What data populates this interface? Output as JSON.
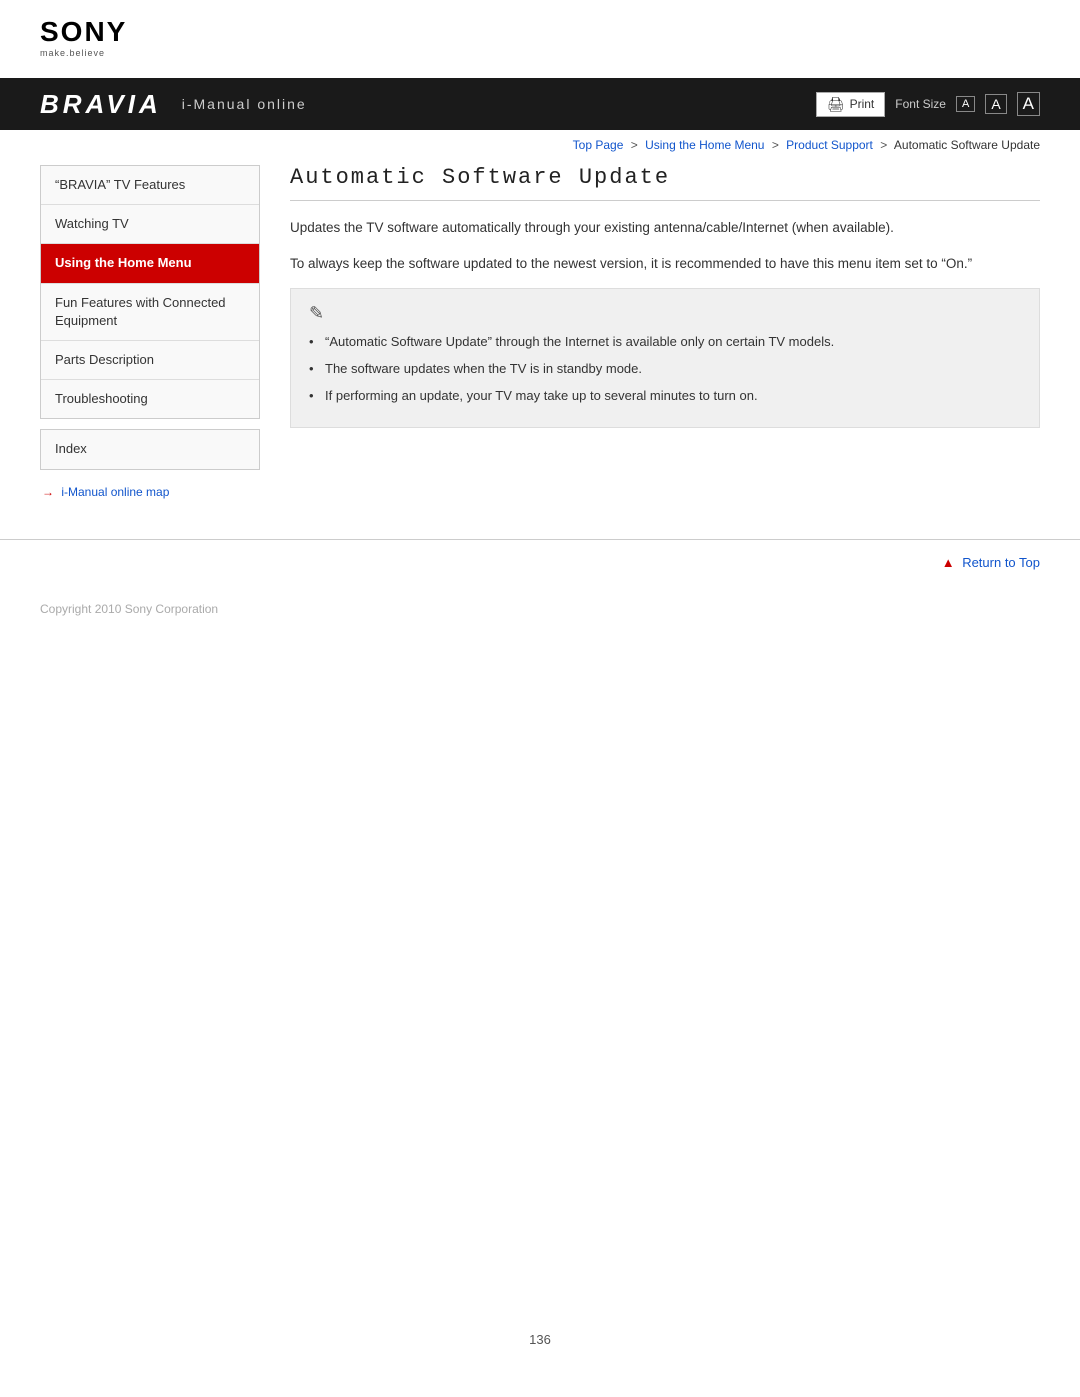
{
  "logo": {
    "brand": "SONY",
    "tagline": "make.believe"
  },
  "banner": {
    "bravia": "BRAVIA",
    "subtitle": "i-Manual online",
    "print_label": "Print",
    "font_size_label": "Font Size",
    "font_small": "A",
    "font_medium": "A",
    "font_large": "A"
  },
  "breadcrumb": {
    "top_page": "Top Page",
    "sep1": ">",
    "using_home": "Using the Home Menu",
    "sep2": ">",
    "product_support": "Product Support",
    "sep3": ">",
    "current": "Automatic Software Update"
  },
  "sidebar": {
    "nav_items": [
      {
        "id": "bravia-features",
        "label": "“BRAVIA” TV Features",
        "active": false
      },
      {
        "id": "watching-tv",
        "label": "Watching TV",
        "active": false
      },
      {
        "id": "using-home-menu",
        "label": "Using the Home Menu",
        "active": true
      },
      {
        "id": "fun-features",
        "label": "Fun Features with Connected Equipment",
        "active": false
      },
      {
        "id": "parts-description",
        "label": "Parts Description",
        "active": false
      },
      {
        "id": "troubleshooting",
        "label": "Troubleshooting",
        "active": false
      }
    ],
    "index_label": "Index",
    "map_arrow": "→",
    "map_link_label": "i-Manual online map"
  },
  "content": {
    "page_title": "Automatic Software Update",
    "para1": "Updates the TV software automatically through your existing antenna/cable/Internet (when available).",
    "para2": "To always keep the software updated to the newest version, it is recommended to have this menu item set to “On.”",
    "note_items": [
      "“Automatic Software Update” through the Internet is available only on certain TV models.",
      "The software updates when the TV is in standby mode.",
      "If performing an update, your TV may take up to several minutes to turn on."
    ]
  },
  "return_to_top": "Return to Top",
  "footer": {
    "copyright": "Copyright 2010 Sony Corporation"
  },
  "page_number": "136"
}
